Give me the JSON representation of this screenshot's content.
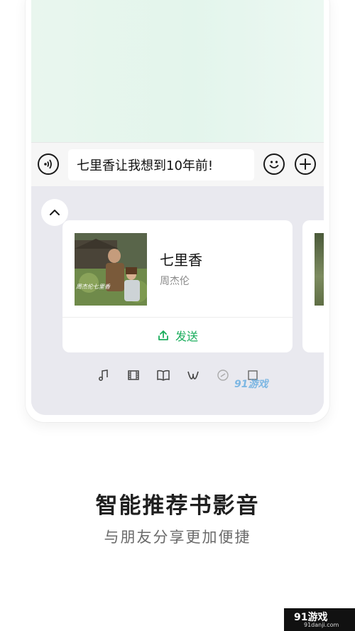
{
  "chat": {
    "input_value": "七里香让我想到10年前!"
  },
  "card": {
    "title": "七里香",
    "artist": "周杰伦",
    "send_label": "发送",
    "album_text": "周杰伦七里香"
  },
  "categories": [
    "music-icon",
    "film-icon",
    "book-icon",
    "w-icon",
    "link-icon",
    "square-icon"
  ],
  "caption": {
    "headline": "智能推荐书影音",
    "subline": "与朋友分享更加便捷"
  },
  "watermark": {
    "overlay": "91游戏",
    "badge_title": "91游戏",
    "badge_sub": "91danji.com"
  },
  "colors": {
    "accent": "#1aad5c",
    "chat_bg": "#e3f5ec",
    "panel_bg": "#e9e9ef"
  }
}
